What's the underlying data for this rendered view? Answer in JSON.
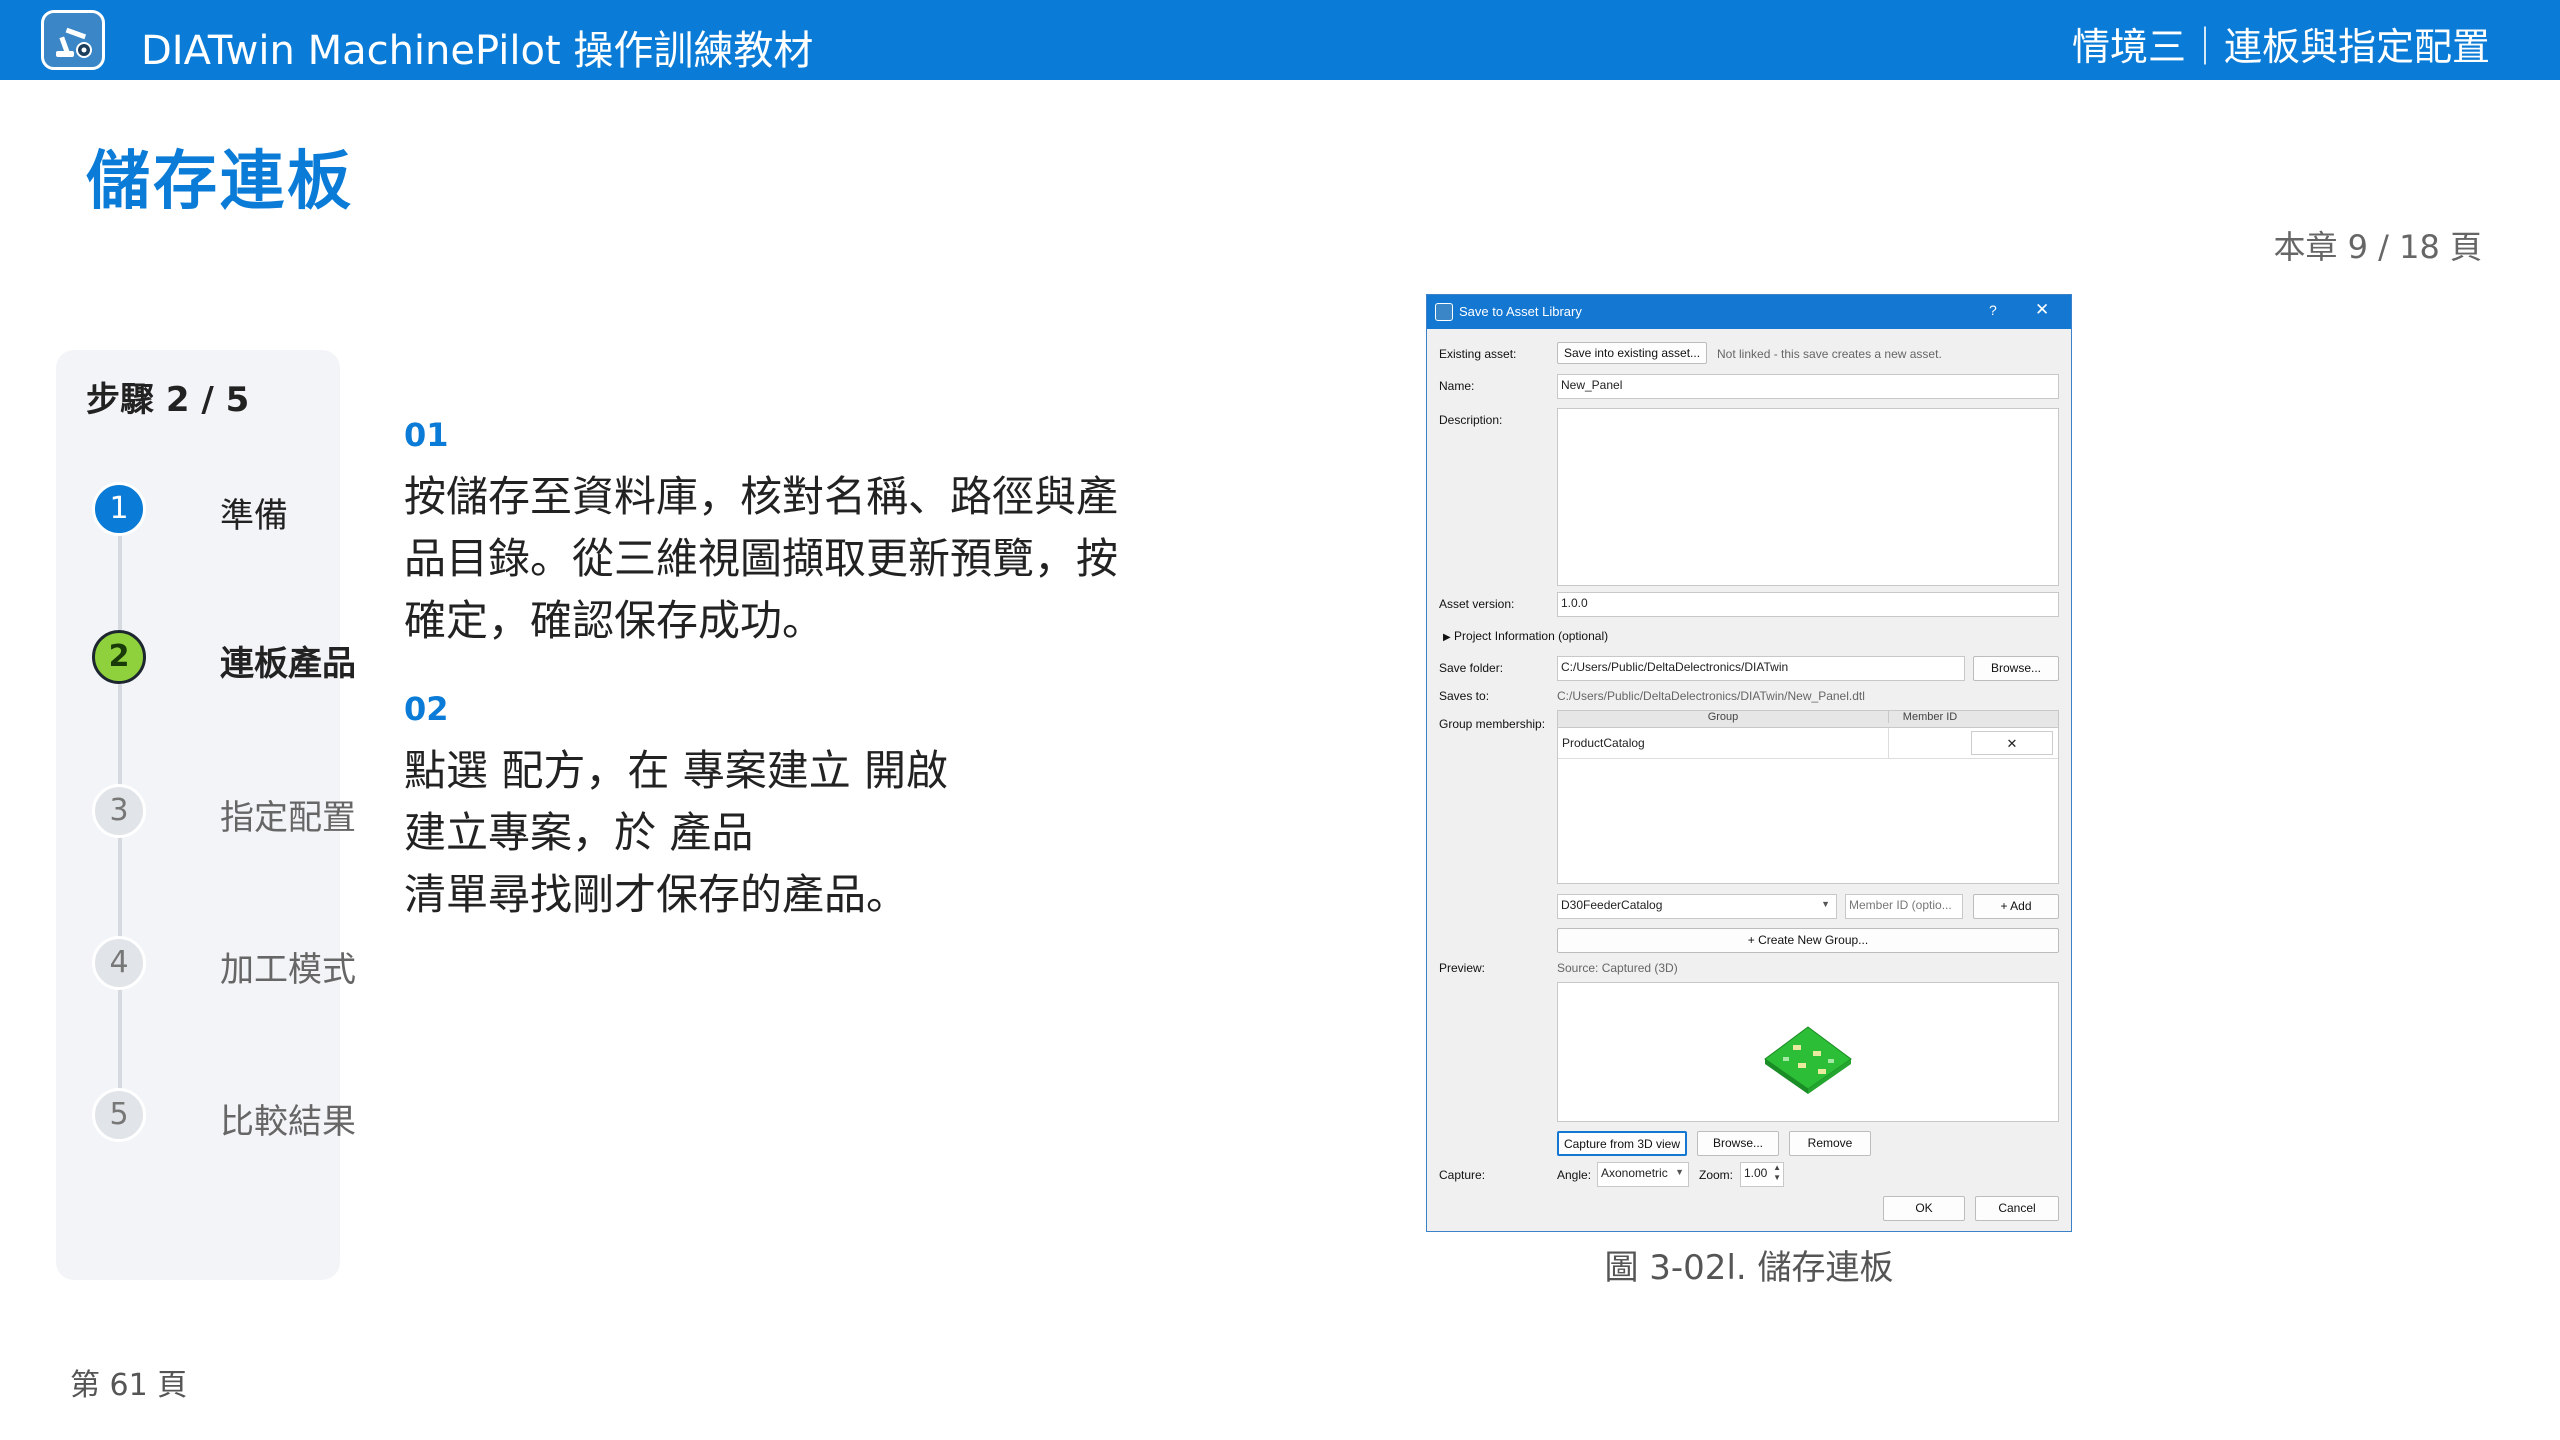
{
  "header": {
    "course_title": "DIATwin MachinePilot 操作訓練教材",
    "scenario": "情境三｜連板與指定配置",
    "logo_icon": "robot-arm-logo-icon"
  },
  "page_title": "儲存連板",
  "chapter_page": "本章 9 / 18 頁",
  "page_number": "第 61 頁",
  "steps": {
    "heading": "步驟 2 / 5",
    "items": [
      {
        "num": "1",
        "label": "準備",
        "state": "done"
      },
      {
        "num": "2",
        "label": "連板產品",
        "state": "active"
      },
      {
        "num": "3",
        "label": "指定配置",
        "state": "todo"
      },
      {
        "num": "4",
        "label": "加工模式",
        "state": "todo"
      },
      {
        "num": "5",
        "label": "比較結果",
        "state": "todo"
      }
    ]
  },
  "instructions": [
    {
      "num": "01",
      "text": "按儲存至資料庫，核對名稱、路徑與產品目錄。從三維視圖擷取更新預覽，按確定，確認保存成功。"
    },
    {
      "num": "02",
      "text": "點選 配方，在 專案建立 開啟\n建立專案，於 產品\n清單尋找剛才保存的產品。"
    }
  ],
  "dialog": {
    "title": "Save to Asset Library",
    "help": "?",
    "close": "✕",
    "existing_asset_label": "Existing asset:",
    "save_existing_button": "Save into existing asset...",
    "not_linked_note": "Not linked - this save creates a new asset.",
    "name_label": "Name:",
    "name_value": "New_Panel",
    "description_label": "Description:",
    "asset_version_label": "Asset version:",
    "asset_version_value": "1.0.0",
    "project_info": "Project Information (optional)",
    "save_folder_label": "Save folder:",
    "save_folder_value": "C:/Users/Public/DeltaDelectronics/DIATwin",
    "browse_button": "Browse...",
    "saves_to_label": "Saves to:",
    "saves_to_value": "C:/Users/Public/DeltaDelectronics/DIATwin/New_Panel.dtl",
    "group_membership_label": "Group membership:",
    "group_col": "Group",
    "member_id_col": "Member ID",
    "group_rows": [
      {
        "group": "ProductCatalog",
        "member_id": "",
        "remove": "✕"
      }
    ],
    "catalog_select": "D30FeederCatalog",
    "member_id_placeholder": "Member ID (optio...",
    "add_button": "+ Add",
    "create_group_button": "+ Create New Group...",
    "preview_label": "Preview:",
    "preview_source": "Source: Captured (3D)",
    "capture_3d_button": "Capture from 3D view",
    "preview_browse_button": "Browse...",
    "remove_button": "Remove",
    "capture_label": "Capture:",
    "angle_label": "Angle:",
    "angle_value": "Axonometric",
    "zoom_label": "Zoom:",
    "zoom_value": "1.00",
    "ok_button": "OK",
    "cancel_button": "Cancel"
  },
  "figure_caption": "圖 3-02l. 儲存連板"
}
